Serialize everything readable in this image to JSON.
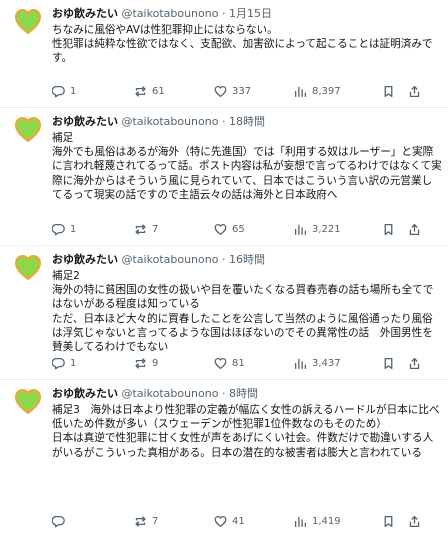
{
  "tweets": [
    {
      "author": {
        "name": "おゆ飲みたい",
        "handle": "@taikotabounono"
      },
      "separator": "·",
      "time": "1月15日",
      "text": "ちなみに風俗やAVは性犯罪抑止にはならない。\n性犯罪は純粋な性欲ではなく、支配欲、加害欲によって起こることは証明済みです。",
      "stats": {
        "replies": "1",
        "retweets": "61",
        "likes": "337",
        "views": "8,397"
      }
    },
    {
      "author": {
        "name": "おゆ飲みたい",
        "handle": "@taikotabounono"
      },
      "separator": "·",
      "time": "18時間",
      "text": "補足\n海外でも風俗はあるが海外（特に先進国）では「利用する奴はルーザー」と実際に言われ軽蔑されてるって話。ポスト内容は私が妄想で言ってるわけではなくて実際に海外からはそういう風に見られていて、日本ではこういう言い訳の元営業してるって現実の話ですので主語云々の話は海外と日本政府へ",
      "stats": {
        "replies": "1",
        "retweets": "7",
        "likes": "65",
        "views": "3,221"
      }
    },
    {
      "author": {
        "name": "おゆ飲みたい",
        "handle": "@taikotabounono"
      },
      "separator": "·",
      "time": "16時間",
      "text": "補足2\n海外の特に貧困国の女性の扱いや目を覆いたくなる買春売春の話も場所も全てではないがある程度は知っている\nただ、日本ほど大々的に買春したことを公言して当然のように風俗通ったり風俗は浮気じゃないと言ってるような国はほぼないのでその異常性の話　外国男性を賛美してるわけでもない",
      "stats": {
        "replies": "1",
        "retweets": "9",
        "likes": "81",
        "views": "3,437"
      }
    },
    {
      "author": {
        "name": "おゆ飲みたい",
        "handle": "@taikotabounono"
      },
      "separator": "·",
      "time": "8時間",
      "text": "補足3　海外は日本より性犯罪の定義が幅広く女性の訴えるハードルが日本に比べ低いため件数が多い（スウェーデンが性犯罪1位件数なのもそのため）\n日本は真逆で性犯罪に甘く女性が声をあげにくい社会。件数だけで勘違いする人がいるがこういった真相がある。日本の潜在的な被害者は膨大と言われている",
      "stats": {
        "replies": "",
        "retweets": "7",
        "likes": "41",
        "views": "1,419"
      }
    }
  ],
  "icons": {
    "avatar": "green-heart-icon",
    "reply": "reply-icon",
    "retweet": "retweet-icon",
    "like": "heart-icon",
    "views": "views-bar-chart-icon",
    "bookmark": "bookmark-icon",
    "share": "share-icon"
  },
  "colors": {
    "avatar_green": "#8bd94a",
    "avatar_orange": "#f2a23a",
    "text": "#0f1419",
    "secondary": "#536471",
    "divider": "#eff3f4"
  }
}
